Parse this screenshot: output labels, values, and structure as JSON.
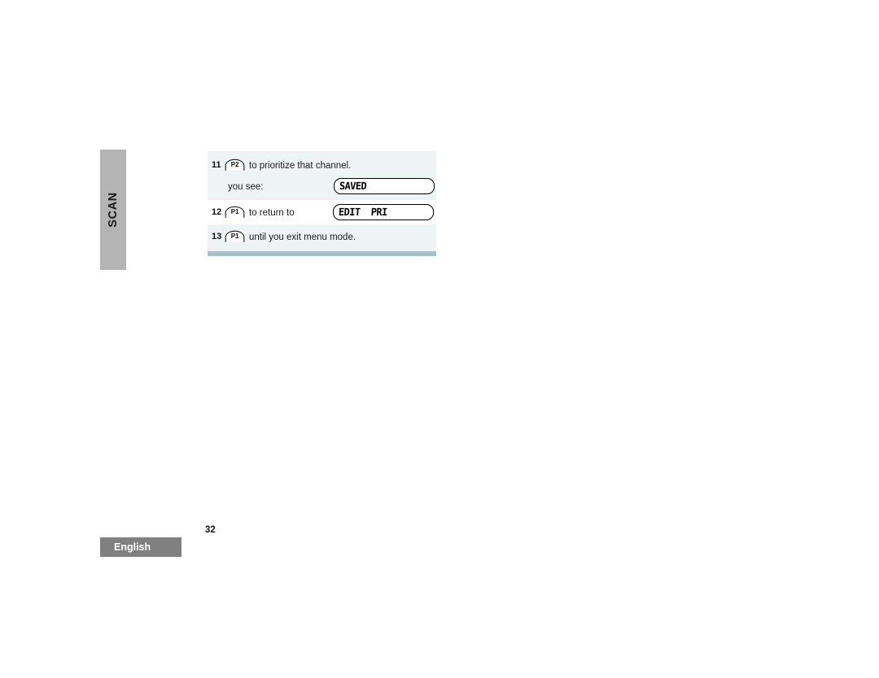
{
  "page": {
    "section_tab_label": "SCAN",
    "page_number": "32",
    "language_badge": "English"
  },
  "procedure": {
    "rows": [
      {
        "step": "11",
        "key_icon": "p2-key-icon",
        "key_label": "P2",
        "text": "to prioritize that channel.",
        "lcd": null
      },
      {
        "step": "",
        "key_icon": null,
        "key_label": "",
        "text": "you see:",
        "lcd": "SAVED"
      },
      {
        "step": "12",
        "key_icon": "p1-key-icon",
        "key_label": "P1",
        "text": "to return to",
        "lcd": "EDIT  PRI"
      },
      {
        "step": "13",
        "key_icon": "p1-key-icon",
        "key_label": "P1",
        "text": "until you exit menu mode.",
        "lcd": null
      }
    ]
  },
  "colors": {
    "row_tint": "#eef3f6",
    "rule": "#a6c1ce",
    "section_tab": "#b4b4b4",
    "footer_badge": "#808080"
  }
}
